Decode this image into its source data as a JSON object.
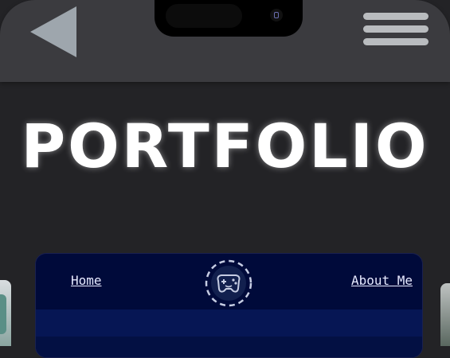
{
  "header": {
    "back_icon": "back-triangle-icon",
    "menu_icon": "hamburger-menu-icon"
  },
  "title": "PORTFOLIO",
  "preview": {
    "nav": {
      "home": "Home",
      "about": "About Me"
    },
    "logo_icon": "gamepad-logo-icon"
  },
  "colors": {
    "background": "#232326",
    "top_bar": "#3b3b3f",
    "title": "#ffffff",
    "card": "#000a3a",
    "accent": "#b9bcbf"
  }
}
